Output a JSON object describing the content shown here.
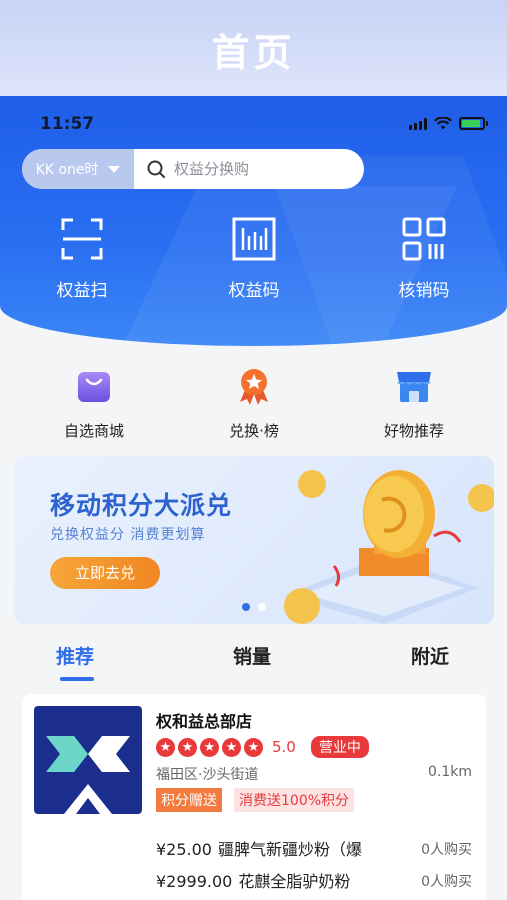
{
  "page": {
    "title": "首页"
  },
  "status_bar": {
    "time": "11:57"
  },
  "search": {
    "city": "KK one时",
    "placeholder": "权益分换购"
  },
  "hero_actions": [
    {
      "label": "权益扫",
      "icon": "scan-icon"
    },
    {
      "label": "权益码",
      "icon": "barcode-icon"
    },
    {
      "label": "核销码",
      "icon": "qr-code-icon"
    }
  ],
  "quick_menu": [
    {
      "label": "自选商城",
      "icon": "shopping-bag-icon"
    },
    {
      "label": "兑换·榜",
      "icon": "medal-icon"
    },
    {
      "label": "好物推荐",
      "icon": "storefront-icon"
    }
  ],
  "banner": {
    "title": "移动积分大派兑",
    "subtitle": "兑换权益分 消费更划算",
    "button": "立即去兑",
    "active_slide": 1,
    "slide_count": 2
  },
  "tabs": [
    "推荐",
    "销量",
    "附近"
  ],
  "store": {
    "name": "权和益总部店",
    "rating": "5.0",
    "stars": 5,
    "status": "营业中",
    "location": "福田区·沙头街道",
    "distance": "0.1km",
    "tags": [
      "积分赠送",
      "消费送100%积分"
    ],
    "products": [
      {
        "price": "¥25.00",
        "name": "疆脾气新疆炒粉（爆",
        "sold": "0人购买"
      },
      {
        "price": "¥2999.00",
        "name": "花麒全脂驴奶粉",
        "sold": "0人购买"
      }
    ]
  },
  "colors": {
    "primary": "#2f6ee9",
    "accent_red": "#e8393b",
    "accent_orange": "#f37b3f"
  }
}
